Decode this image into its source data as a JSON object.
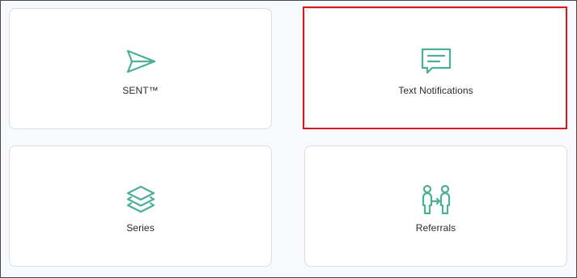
{
  "colors": {
    "accent": "#4caf96",
    "highlight": "#d8161d",
    "card_border": "#dcdde3",
    "background": "#f8f9fc"
  },
  "cards": [
    {
      "label": "SENT™",
      "icon": "send-icon"
    },
    {
      "label": "Text Notifications",
      "icon": "chat-message-icon",
      "highlighted": true
    },
    {
      "label": "Series",
      "icon": "layers-icon"
    },
    {
      "label": "Referrals",
      "icon": "referral-people-icon"
    }
  ]
}
